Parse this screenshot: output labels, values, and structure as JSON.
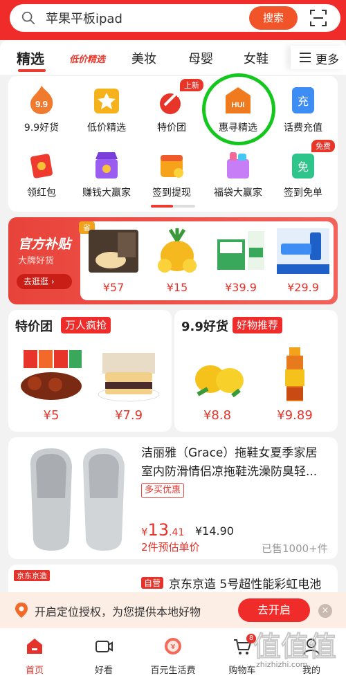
{
  "search": {
    "query": "苹果平板ipad",
    "button": "搜索"
  },
  "tabs": [
    {
      "label": "精选"
    },
    {
      "label": "低价精选"
    },
    {
      "label": "美妆"
    },
    {
      "label": "母婴"
    },
    {
      "label": "女鞋"
    }
  ],
  "more_label": "更多",
  "grid": [
    {
      "label": "9.9好货",
      "icon": "9.9-icon",
      "icon_text": "9.9"
    },
    {
      "label": "低价精选",
      "icon": "star-bag-icon"
    },
    {
      "label": "特价团",
      "icon": "arrow-icon",
      "badge": "上新"
    },
    {
      "label": "惠寻精选",
      "icon": "hui-icon",
      "icon_text": "HUI"
    },
    {
      "label": "话费充值",
      "icon": "phone-icon",
      "icon_text": "充"
    },
    {
      "label": "领红包",
      "icon": "red-envelope-icon"
    },
    {
      "label": "赚钱大赢家",
      "icon": "store-icon"
    },
    {
      "label": "签到提现",
      "icon": "calendar-icon"
    },
    {
      "label": "福袋大赢家",
      "icon": "gift-box-icon"
    },
    {
      "label": "签到免单",
      "icon": "free-icon",
      "icon_text": "免",
      "badge": "免费"
    }
  ],
  "banner": {
    "title": "官方补贴",
    "subtitle": "大牌好货",
    "button": "去逛逛",
    "corner_badge": "省",
    "products": [
      {
        "price": "¥57",
        "icon": "noodle-gift-box"
      },
      {
        "price": "¥15",
        "icon": "pineapple"
      },
      {
        "price": "¥39.9",
        "icon": "milk-cartons"
      },
      {
        "price": "¥29.9",
        "icon": "toothpaste"
      }
    ]
  },
  "deals": [
    {
      "title": "特价团",
      "tag": "万人疯抢",
      "items": [
        {
          "price": "¥5",
          "icon": "duck-neck-snack"
        },
        {
          "price": "¥7.9",
          "icon": "sandwich"
        }
      ]
    },
    {
      "title": "9.9好货",
      "tag": "好物推荐",
      "items": [
        {
          "price": "¥8.8",
          "icon": "lemons"
        },
        {
          "price": "¥9.89",
          "icon": "iced-tea-bottle"
        }
      ]
    }
  ],
  "product": {
    "title": "洁丽雅（Grace）拖鞋女夏季家居室内防滑情侣凉拖鞋洗澡防臭轻...",
    "tag": "多买优惠",
    "price_yen": "¥",
    "price_int": "13",
    "price_dec": ".41",
    "orig_price": "¥14.90",
    "unit_note": "2件预估单价",
    "sold": "已售1000+件"
  },
  "product2": {
    "shop": "京东京造",
    "tag": "自营",
    "title": "京东京造 5号超性能彩虹电池"
  },
  "location_bar": {
    "text": "开启定位授权，为您提供本地好物",
    "button": "去开启",
    "close": "×"
  },
  "nav": [
    {
      "label": "首页",
      "active": true
    },
    {
      "label": "好看"
    },
    {
      "label": "百元生活费"
    },
    {
      "label": "购物车",
      "badge": "8"
    },
    {
      "label": "我的"
    }
  ],
  "watermark": {
    "text": "zhizhizhi.com",
    "logo": "值值值"
  }
}
